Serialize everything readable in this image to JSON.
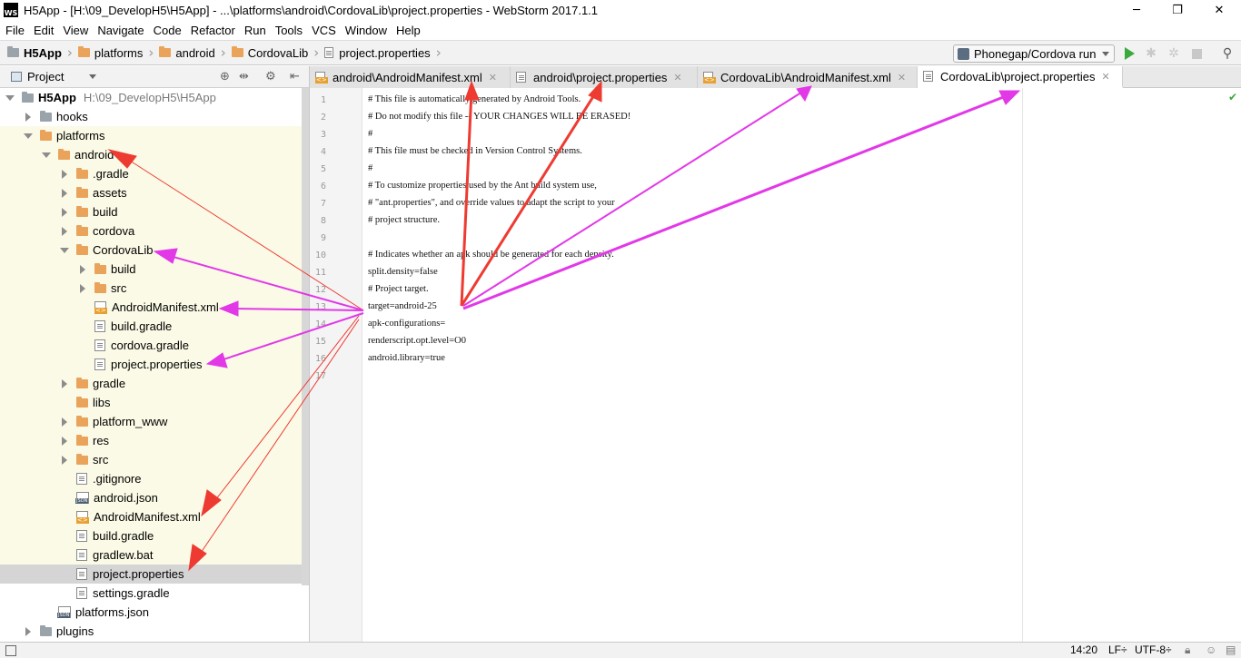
{
  "window": {
    "title": "H5App - [H:\\09_DevelopH5\\H5App] - ...\\platforms\\android\\CordovaLib\\project.properties - WebStorm 2017.1.1",
    "app_logo_text": "WS",
    "min_glyph": "─",
    "restore_glyph": "❐",
    "close_glyph": "✕"
  },
  "menu": [
    "File",
    "Edit",
    "View",
    "Navigate",
    "Code",
    "Refactor",
    "Run",
    "Tools",
    "VCS",
    "Window",
    "Help"
  ],
  "breadcrumb": {
    "items": [
      "H5App",
      "platforms",
      "android",
      "CordovaLib",
      "project.properties"
    ],
    "separator": "›"
  },
  "run_config": {
    "label": "Phonegap/Cordova run"
  },
  "project_panel": {
    "title": "Project",
    "tree": [
      {
        "label": "H5App",
        "path": "H:\\09_DevelopH5\\H5App",
        "type": "root",
        "depth": 0,
        "arrow": "down"
      },
      {
        "label": "hooks",
        "type": "folder-grey",
        "depth": 1,
        "arrow": "right"
      },
      {
        "label": "platforms",
        "type": "folder",
        "depth": 1,
        "arrow": "down"
      },
      {
        "label": "android",
        "type": "folder",
        "depth": 2,
        "arrow": "down"
      },
      {
        "label": ".gradle",
        "type": "folder",
        "depth": 3,
        "arrow": "right"
      },
      {
        "label": "assets",
        "type": "folder",
        "depth": 3,
        "arrow": "right"
      },
      {
        "label": "build",
        "type": "folder",
        "depth": 3,
        "arrow": "right"
      },
      {
        "label": "cordova",
        "type": "folder",
        "depth": 3,
        "arrow": "right"
      },
      {
        "label": "CordovaLib",
        "type": "folder",
        "depth": 3,
        "arrow": "down"
      },
      {
        "label": "build",
        "type": "folder",
        "depth": 4,
        "arrow": "right"
      },
      {
        "label": "src",
        "type": "folder",
        "depth": 4,
        "arrow": "right"
      },
      {
        "label": "AndroidManifest.xml",
        "type": "xml",
        "depth": 4,
        "arrow": "none"
      },
      {
        "label": "build.gradle",
        "type": "file",
        "depth": 4,
        "arrow": "none"
      },
      {
        "label": "cordova.gradle",
        "type": "file",
        "depth": 4,
        "arrow": "none"
      },
      {
        "label": "project.properties",
        "type": "file",
        "depth": 4,
        "arrow": "none"
      },
      {
        "label": "gradle",
        "type": "folder",
        "depth": 3,
        "arrow": "right"
      },
      {
        "label": "libs",
        "type": "folder",
        "depth": 3,
        "arrow": "none"
      },
      {
        "label": "platform_www",
        "type": "folder",
        "depth": 3,
        "arrow": "right"
      },
      {
        "label": "res",
        "type": "folder",
        "depth": 3,
        "arrow": "right"
      },
      {
        "label": "src",
        "type": "folder",
        "depth": 3,
        "arrow": "right"
      },
      {
        "label": ".gitignore",
        "type": "file",
        "depth": 3,
        "arrow": "none"
      },
      {
        "label": "android.json",
        "type": "json",
        "depth": 3,
        "arrow": "none"
      },
      {
        "label": "AndroidManifest.xml",
        "type": "xml",
        "depth": 3,
        "arrow": "none"
      },
      {
        "label": "build.gradle",
        "type": "file",
        "depth": 3,
        "arrow": "none"
      },
      {
        "label": "gradlew.bat",
        "type": "file",
        "depth": 3,
        "arrow": "none"
      },
      {
        "label": "project.properties",
        "type": "file",
        "depth": 3,
        "arrow": "none",
        "selected": true
      },
      {
        "label": "settings.gradle",
        "type": "file",
        "depth": 3,
        "arrow": "none"
      },
      {
        "label": "platforms.json",
        "type": "json",
        "depth": 2,
        "arrow": "none"
      },
      {
        "label": "plugins",
        "type": "folder-grey",
        "depth": 1,
        "arrow": "right"
      }
    ]
  },
  "editor_tabs": [
    {
      "label": "android\\AndroidManifest.xml",
      "icon": "xml"
    },
    {
      "label": "android\\project.properties",
      "icon": "file"
    },
    {
      "label": "CordovaLib\\AndroidManifest.xml",
      "icon": "xml"
    },
    {
      "label": "CordovaLib\\project.properties",
      "icon": "file",
      "active": true
    }
  ],
  "tab_close_glyph": "✕",
  "code_lines": [
    "# This file is automatically generated by Android Tools.",
    "# Do not modify this file -- YOUR CHANGES WILL BE ERASED!",
    "#",
    "# This file must be checked in Version Control Systems.",
    "#",
    "# To customize properties used by the Ant build system use,",
    "# \"ant.properties\", and override values to adapt the script to your",
    "# project structure.",
    "",
    "# Indicates whether an apk should be generated for each density.",
    "split.density=false",
    "# Project target.",
    "target=android-25",
    "apk-configurations=",
    "renderscript.opt.level=O0",
    "android.library=true",
    ""
  ],
  "line_numbers": [
    "1",
    "2",
    "3",
    "4",
    "5",
    "6",
    "7",
    "8",
    "9",
    "10",
    "11",
    "12",
    "13",
    "14",
    "15",
    "16",
    "17"
  ],
  "status_bar": {
    "position": "14:20",
    "line_sep": "LF÷",
    "encoding": "UTF-8÷"
  },
  "colors": {
    "folder": "#e9a35a",
    "red_arrow": "#ee3b32",
    "magenta_arrow": "#e238e8",
    "highlight": "#fbfae6"
  }
}
